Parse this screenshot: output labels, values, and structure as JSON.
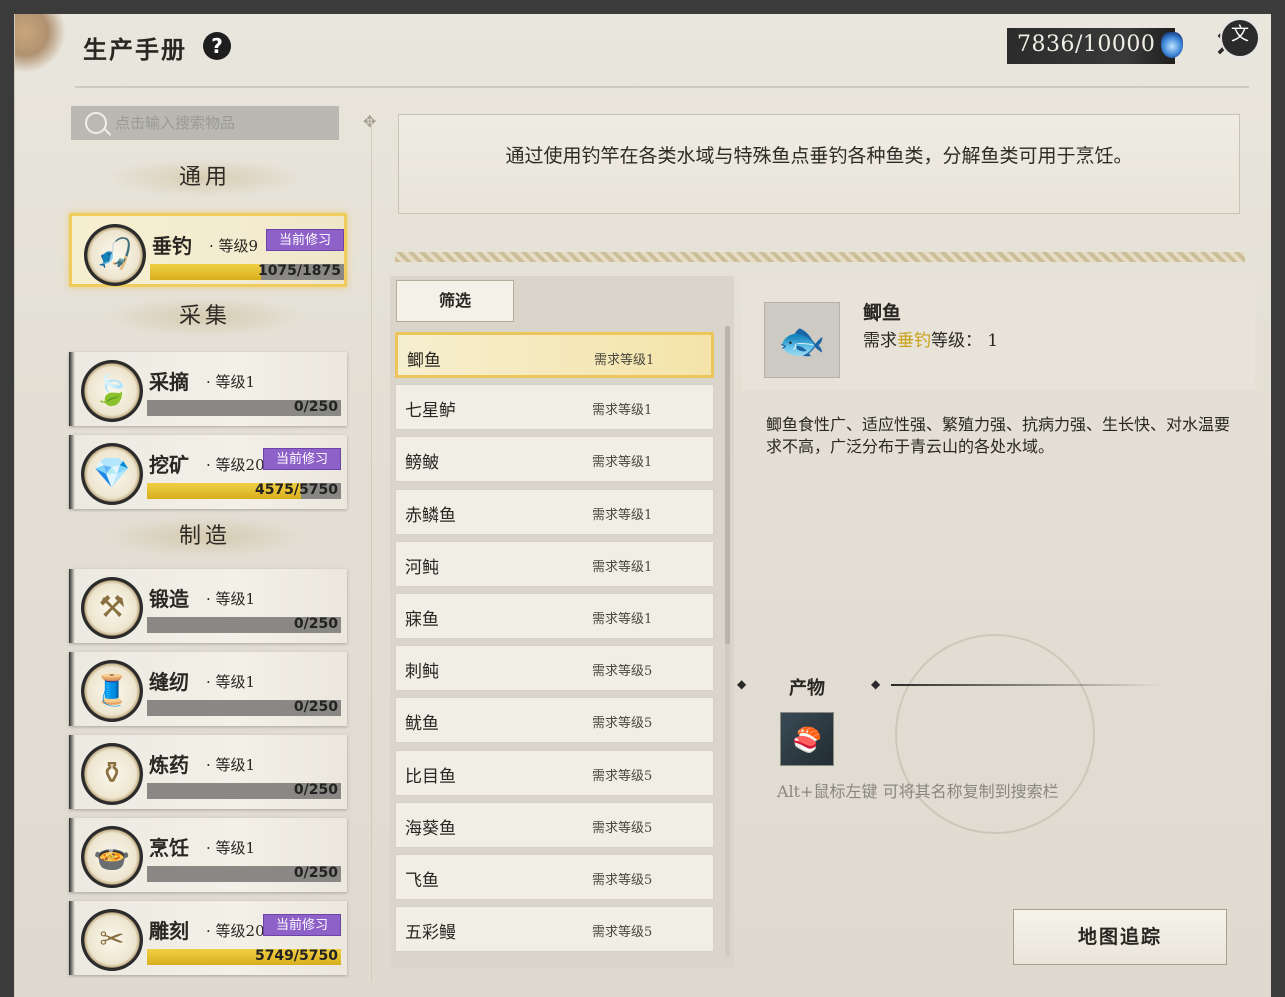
{
  "header": {
    "title": "生产手册",
    "help_symbol": "?",
    "energy": "7836/10000",
    "close_symbol": "✕",
    "translate_symbol": "文"
  },
  "search": {
    "placeholder": "点击输入搜索物品"
  },
  "categories": [
    {
      "label": "通用"
    },
    {
      "label": "采集"
    },
    {
      "label": "制造"
    }
  ],
  "skills": [
    {
      "name": "垂钓",
      "level": "· 等级9",
      "badge": "当前修习",
      "progress_text": "1075/1875",
      "progress": 0.573,
      "icon": "fishing-rod-icon"
    },
    {
      "name": "采摘",
      "level": "· 等级1",
      "badge": "",
      "progress_text": "0/250",
      "progress": 0,
      "icon": "leaf-icon"
    },
    {
      "name": "挖矿",
      "level": "· 等级20",
      "badge": "当前修习",
      "progress_text": "4575/5750",
      "progress": 0.796,
      "icon": "crystal-icon"
    },
    {
      "name": "锻造",
      "level": "· 等级1",
      "badge": "",
      "progress_text": "0/250",
      "progress": 0,
      "icon": "anvil-icon"
    },
    {
      "name": "缝纫",
      "level": "· 等级1",
      "badge": "",
      "progress_text": "0/250",
      "progress": 0,
      "icon": "thread-icon"
    },
    {
      "name": "炼药",
      "level": "· 等级1",
      "badge": "",
      "progress_text": "0/250",
      "progress": 0,
      "icon": "gourd-icon"
    },
    {
      "name": "烹饪",
      "level": "· 等级1",
      "badge": "",
      "progress_text": "0/250",
      "progress": 0,
      "icon": "pot-icon"
    },
    {
      "name": "雕刻",
      "level": "· 等级20",
      "badge": "当前修习",
      "progress_text": "5749/5750",
      "progress": 0.9998,
      "icon": "chisel-icon"
    }
  ],
  "description": "通过使用钓竿在各类水域与特殊鱼点垂钓各种鱼类，分解鱼类可用于烹饪。",
  "filter_label": "筛选",
  "fish_list": [
    {
      "name": "鲫鱼",
      "req": "需求等级1"
    },
    {
      "name": "七星鲈",
      "req": "需求等级1"
    },
    {
      "name": "鳑鲏",
      "req": "需求等级1"
    },
    {
      "name": "赤鳞鱼",
      "req": "需求等级1"
    },
    {
      "name": "河鲀",
      "req": "需求等级1"
    },
    {
      "name": "寐鱼",
      "req": "需求等级1"
    },
    {
      "name": "刺鲀",
      "req": "需求等级5"
    },
    {
      "name": "鱿鱼",
      "req": "需求等级5"
    },
    {
      "name": "比目鱼",
      "req": "需求等级5"
    },
    {
      "name": "海葵鱼",
      "req": "需求等级5"
    },
    {
      "name": "飞鱼",
      "req": "需求等级5"
    },
    {
      "name": "五彩鳗",
      "req": "需求等级5"
    }
  ],
  "detail": {
    "name": "鲫鱼",
    "req_prefix": "需求",
    "req_skill": "垂钓",
    "req_suffix": "等级：",
    "req_level": "1",
    "description": "鲫鱼食性广、适应性强、繁殖力强、抗病力强、生长快、对水温要求不高，广泛分布于青云山的各处水域。",
    "output_title": "产物",
    "hint": "Alt+鼠标左键 可将其名称复制到搜索栏",
    "track_button": "地图追踪"
  },
  "colors": {
    "accent_gold": "#f0cb5e",
    "badge_purple": "#8e61c8",
    "progress_yellow": "#f0cf45"
  }
}
